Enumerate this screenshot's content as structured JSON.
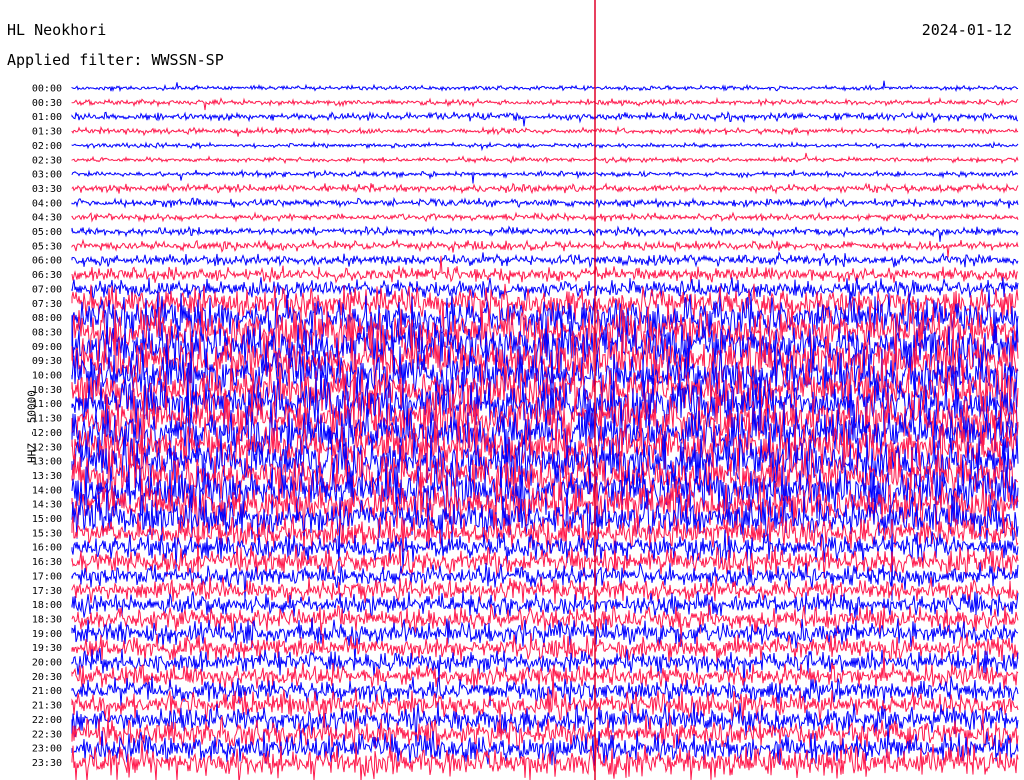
{
  "header": {
    "station": "HL Neokhori",
    "date": "2024-01-12",
    "filter": "Applied filter: WWSSN-SP"
  },
  "chart_data": {
    "type": "line",
    "title": "HL Neokhori",
    "ylabel": "HHZ - 50000",
    "colors": [
      "#0000ff",
      "#ff1a4d"
    ],
    "marker_color": "#e0002a",
    "row_labels": [
      "00:00",
      "00:30",
      "01:00",
      "01:30",
      "02:00",
      "02:30",
      "03:00",
      "03:30",
      "04:00",
      "04:30",
      "05:00",
      "05:30",
      "06:00",
      "06:30",
      "07:00",
      "07:30",
      "08:00",
      "08:30",
      "09:00",
      "09:30",
      "10:00",
      "10:30",
      "11:00",
      "11:30",
      "12:00",
      "12:30",
      "13:00",
      "13:30",
      "14:00",
      "14:30",
      "15:00",
      "15:30",
      "16:00",
      "16:30",
      "17:00",
      "17:30",
      "18:00",
      "18:30",
      "19:00",
      "19:30",
      "20:00",
      "20:30",
      "21:00",
      "21:30",
      "22:00",
      "22:30",
      "23:00",
      "23:30"
    ],
    "activity_level": [
      0.05,
      0.08,
      0.12,
      0.08,
      0.05,
      0.06,
      0.08,
      0.12,
      0.12,
      0.1,
      0.12,
      0.15,
      0.2,
      0.25,
      0.35,
      0.6,
      0.85,
      0.9,
      0.95,
      0.95,
      0.95,
      0.95,
      0.95,
      0.95,
      0.95,
      0.95,
      0.95,
      0.95,
      0.95,
      0.9,
      0.8,
      0.6,
      0.5,
      0.5,
      0.4,
      0.4,
      0.4,
      0.45,
      0.45,
      0.45,
      0.4,
      0.4,
      0.45,
      0.5,
      0.5,
      0.55,
      0.55,
      0.6
    ]
  }
}
